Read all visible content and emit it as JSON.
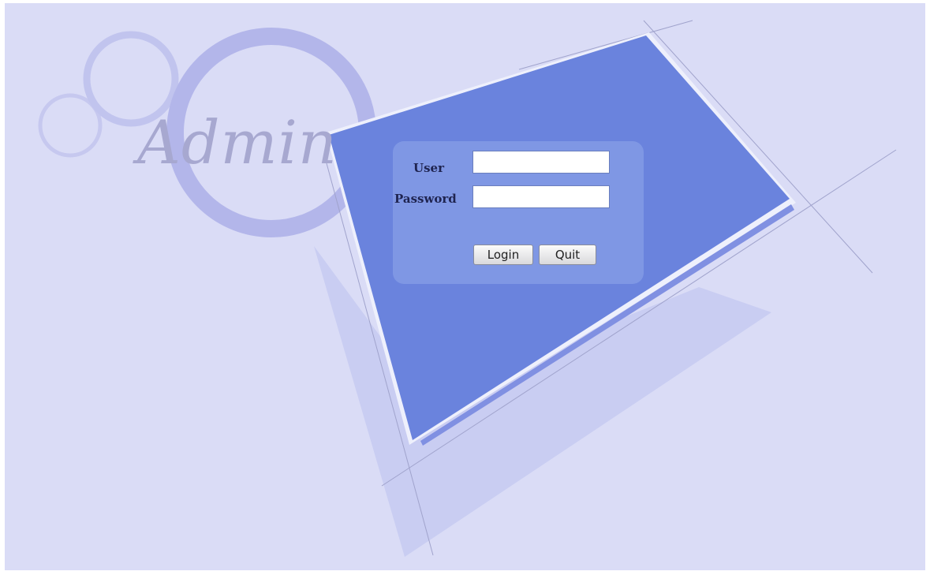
{
  "brand": {
    "text": "Admin"
  },
  "login": {
    "user_label": "User",
    "password_label": "Password",
    "user_value": "",
    "password_value": "",
    "login_button": "Login",
    "quit_button": "Quit"
  },
  "colors": {
    "background": "#dadcf6",
    "panel_blue": "#6a83dd",
    "form_box": "#7f97e4",
    "ring": "#b3b6ea",
    "brand_text": "#a7a8d0"
  }
}
